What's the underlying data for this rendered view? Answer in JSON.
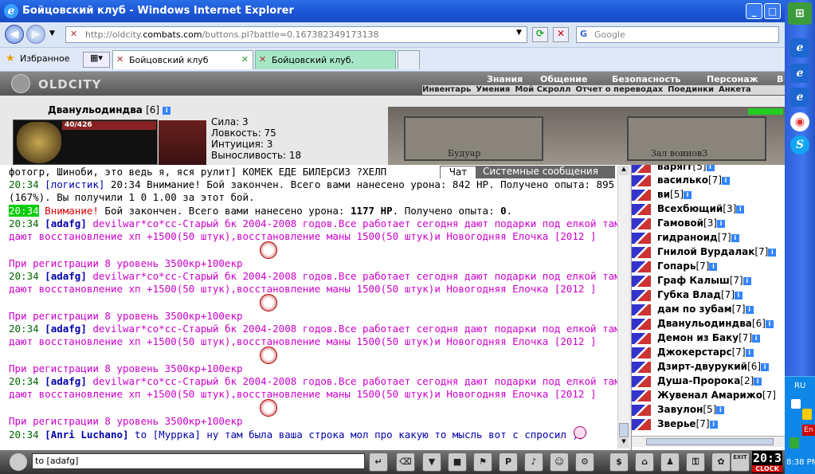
{
  "window": {
    "title": "Бойцовский клуб - Windows Internet Explorer"
  },
  "address": {
    "url_prefix": "http://oldcity.",
    "url_domain": "combats.com",
    "url_path": "/buttons.pl?battle=0.167382349173138",
    "search_placeholder": "Google"
  },
  "favorites_label": "Избранное",
  "tabs": [
    {
      "label": "Бойцовский клуб"
    },
    {
      "label": "Бойцовский клуб."
    }
  ],
  "game": {
    "logo": "OLDCITY",
    "menu_top": [
      "Знания",
      "Общение",
      "Безопасность",
      "Персонаж",
      "В"
    ],
    "menu_sub": [
      "Инвентарь",
      "Умения",
      "Мой Скролл",
      "Отчет о переводах",
      "Поединки",
      "Анкета"
    ],
    "character": {
      "name": "Дванульодиндва",
      "level": "[6]",
      "hp": "40/426",
      "stats": [
        "Сила: 3",
        "Ловкость: 75",
        "Интуиция: 3",
        "Выносливость: 18"
      ]
    },
    "scene_labels": [
      "Будуар",
      "Зал воинов3"
    ],
    "chat_tabs": [
      "Чат",
      "Системные сообщения"
    ],
    "chat": {
      "l0": "фотогр, Шиноби, это ведь я, яся рулит] КОМЕК ЕДЕ БИЛЕрСИЗ ?ХЕЛП",
      "l1_time": "20:34",
      "l1_nick": "[логистик]",
      "l1_text": " 20:34 Внимание! Бой закончен. Всего вами нанесено урона: 842 HP. Получено опыта: 895",
      "l2": "(167%). Вы получили 1 0 1.00 за этот бой.",
      "l3_time": "20:34",
      "l3_warn": " Внимание!",
      "l3_text": " Бой закончен. Всего вами нанесено урона: ",
      "l3_hp": "1177 HP",
      "l3_text2": ". Получено опыта: ",
      "l3_exp": "0",
      "l3_end": ".",
      "spam_time": "20:34",
      "spam_nick": "[adafg]",
      "spam_a": " devilwar*co*cc-Старый бк 2004-2008 годов.Все работает сегодня дают подарки под елкой там",
      "spam_b": "дают восстановление хп +1500(50 штук),восстановление маны 1500(50 штук)и Новогодняя Елочка [2012 ]",
      "spam_c": "При регистрации 8 уровень 3500кр+100екр",
      "last_time": "20:34",
      "last_nick": "[Anri Luchano]",
      "last_to": " to ",
      "last_target": "[Муррка]",
      "last_text": " ну там была ваша строка мол про какую то мысль вот с спросил ))"
    },
    "users": [
      {
        "name": "варягг",
        "lv": "[5]"
      },
      {
        "name": "василько",
        "lv": "[7]"
      },
      {
        "name": "ви",
        "lv": "[5]"
      },
      {
        "name": "Всехбющий",
        "lv": "[3]"
      },
      {
        "name": "Гамовой",
        "lv": "[3]"
      },
      {
        "name": "гидраноид",
        "lv": "[7]"
      },
      {
        "name": "Гнилой Вурдалак",
        "lv": "[7]"
      },
      {
        "name": "Гопарь",
        "lv": "[7]"
      },
      {
        "name": "Граф Калыш",
        "lv": "[7]"
      },
      {
        "name": "Губка Влад",
        "lv": "[7]"
      },
      {
        "name": "дам по зубам",
        "lv": "[7]"
      },
      {
        "name": "Дванульодиндва",
        "lv": "[6]"
      },
      {
        "name": "Демон из Баку",
        "lv": "[7]"
      },
      {
        "name": "Джокерстарс",
        "lv": "[7]"
      },
      {
        "name": "Дзирт-двурукий",
        "lv": "[6]"
      },
      {
        "name": "Душа-Пророка",
        "lv": "[2]"
      },
      {
        "name": "Жувенал Амарижо",
        "lv": "[7]"
      },
      {
        "name": "Завулон",
        "lv": "[5]"
      },
      {
        "name": "Зверье",
        "lv": "[7]"
      }
    ],
    "input_value": "to [adafg]",
    "clock": "20:3",
    "clock_label": "CLOCK",
    "exit_label": "EXIT"
  },
  "taskbar": {
    "lang": "RU",
    "lang2": "En",
    "time": "8:38 PM"
  }
}
